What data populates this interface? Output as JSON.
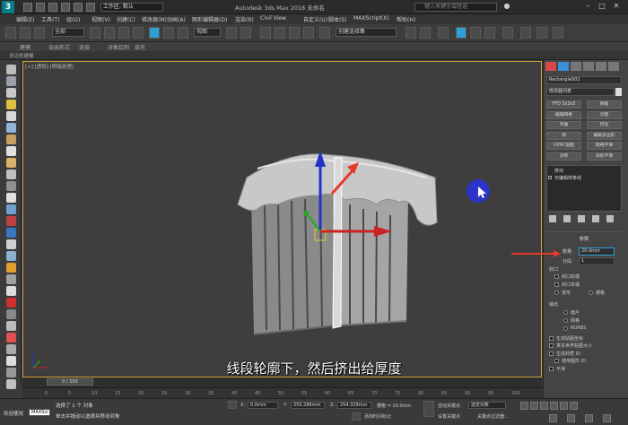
{
  "title_bar": {
    "workspace_label": "工作区: 默认",
    "app_title": "Autodesk 3ds Max 2018  未命名",
    "search_placeholder": "键入关键字或短语"
  },
  "menu": [
    "编辑(E)",
    "工具(T)",
    "组(G)",
    "视图(V)",
    "创建(C)",
    "修改器(M)",
    "动画(A)",
    "图形编辑器(D)",
    "渲染(R)",
    "Civil View",
    "自定义(U)",
    "脚本(S)",
    "MAXScript(X)",
    "帮助(H)"
  ],
  "toolbar": {
    "selection_filter": "全部",
    "ref_coord": "视图",
    "named_selection": "创建选择集"
  },
  "ribbon_tabs": [
    "建模",
    "自由形式",
    "选择",
    "对象绘制",
    "填充"
  ],
  "ribbon_sub": "多边形建模",
  "viewport": {
    "label": "[+] [透视] [明暗处理]",
    "caption": "线段轮廓下，然后挤出给厚度"
  },
  "command_panel": {
    "object_name": "Rectangle002",
    "modifier_list": "修改器列表",
    "buttons": [
      "FFD 3x3x3",
      "倒角",
      "编辑网格",
      "切割",
      "弯曲",
      "挤出",
      "壳",
      "编辑多边形",
      "UVW 贴图",
      "网格平滑",
      "对称",
      "涡轮平滑"
    ],
    "stack_items": [
      "挤出",
      "可编辑样条线"
    ],
    "params_title": "参数",
    "amount_label": "数量:",
    "amount_value": "20.0mm",
    "segments_label": "分段:",
    "segments_value": "1",
    "capping_title": "封口",
    "cap_start": "封口始端",
    "cap_end": "封口末端",
    "morph": "变形",
    "grid": "栅格",
    "output_title": "输出",
    "output_options": [
      "面片",
      "网格",
      "NURBS"
    ],
    "gen_map_coords": "生成贴图坐标",
    "real_world": "真实世界贴图大小",
    "gen_mat_ids": "生成材质 ID",
    "use_shape_ids": "使用图形 ID",
    "smooth": "平滑"
  },
  "timeline": {
    "frame": "0 / 100",
    "ruler_marks": [
      "0",
      "5",
      "10",
      "15",
      "20",
      "25",
      "30",
      "35",
      "40",
      "45",
      "50",
      "55",
      "60",
      "65",
      "70",
      "75",
      "80",
      "85",
      "90",
      "95",
      "100"
    ]
  },
  "status": {
    "welcome": "欢迎使用",
    "maxscript": "MAXScr",
    "selected": "选择了 1 个 对象",
    "prompt": "单击并拖动以选择并移动对象",
    "x_label": "X:",
    "x_value": "0.0mm",
    "y_label": "Y:",
    "y_value": "250.286mm",
    "z_label": "Z:",
    "z_value": "254.329mm",
    "grid": "栅格 = 10.0mm",
    "add_time_tag": "添加时间标记",
    "auto_key": "自动关键点",
    "set_key": "设置关键点",
    "selected_obj": "选定对象",
    "key_filter": "关键点过滤器..."
  },
  "colors": {
    "accent": "#2f9fd8",
    "viewport_border": "#cfa33a",
    "arrow": "#e53a2a"
  }
}
